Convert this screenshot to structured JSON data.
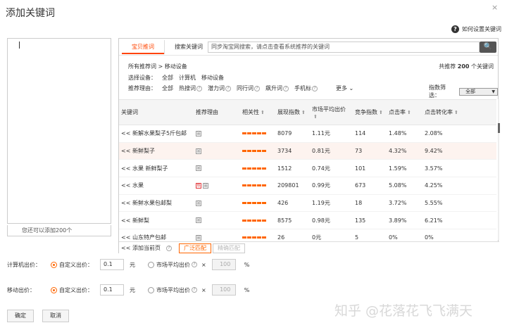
{
  "dialog": {
    "title": "添加关键词",
    "close_glyph": "×"
  },
  "help": {
    "icon_glyph": "?",
    "label": "如何设置关键词"
  },
  "left_panel": {
    "info": "您还可以添加200个"
  },
  "tabs": [
    {
      "label": "宝贝推词",
      "active": true
    },
    {
      "label": "搜索关键词",
      "active": false
    }
  ],
  "search": {
    "value": "同步淘宝网搜索，请点击查看系统推荐的关键词",
    "button_glyph": "🔍"
  },
  "breadcrumb": {
    "root": "所有推荐词",
    "sep": ">",
    "current": "移动设备"
  },
  "recommend": {
    "prefix": "共推荐",
    "count": "200",
    "suffix": "个关键词"
  },
  "device_filter": {
    "label": "选择设备：",
    "options": [
      "全部",
      "计算机",
      "移动设备"
    ]
  },
  "reason_filter": {
    "label": "推荐理由：",
    "options": [
      "全部",
      "热搜词",
      "潜力词",
      "同行词",
      "飙升词",
      "手机标"
    ],
    "more": "更多"
  },
  "index_filter": {
    "label": "指数筛选：",
    "value": "全部"
  },
  "table": {
    "headers": [
      "关键词",
      "推荐理由",
      "相关性",
      "展现指数",
      "市场平均出价",
      "竞争指数",
      "点击率",
      "点击转化率"
    ],
    "sort_glyph": "⬆",
    "add_glyph": "<<",
    "rows": [
      {
        "keyword": "新解水果梨子5斤包邮",
        "reason": [
          "品"
        ],
        "impr": "8079",
        "bid": "1.11元",
        "comp": "114",
        "ctr": "1.48%",
        "cvr": "2.08%"
      },
      {
        "keyword": "新鲜梨子",
        "reason": [
          "品"
        ],
        "impr": "3734",
        "bid": "0.81元",
        "comp": "73",
        "ctr": "4.32%",
        "cvr": "9.42%"
      },
      {
        "keyword": "水果 新鲜梨子",
        "reason": [
          "品"
        ],
        "impr": "1512",
        "bid": "0.74元",
        "comp": "101",
        "ctr": "1.59%",
        "cvr": "3.57%"
      },
      {
        "keyword": "水果",
        "reason": [
          "热",
          "品"
        ],
        "impr": "209801",
        "bid": "0.99元",
        "comp": "673",
        "ctr": "5.08%",
        "cvr": "4.25%"
      },
      {
        "keyword": "新鲜水果包邮梨",
        "reason": [
          "品"
        ],
        "impr": "426",
        "bid": "1.19元",
        "comp": "18",
        "ctr": "3.72%",
        "cvr": "5.55%"
      },
      {
        "keyword": "新鲜梨",
        "reason": [
          "品"
        ],
        "impr": "8575",
        "bid": "0.98元",
        "comp": "135",
        "ctr": "3.89%",
        "cvr": "6.21%"
      },
      {
        "keyword": "山东特产包邮",
        "reason": [
          "品"
        ],
        "impr": "26",
        "bid": "0元",
        "comp": "5",
        "ctr": "0%",
        "cvr": "0%"
      }
    ]
  },
  "bottom_bar": {
    "add_page": "<< 添加当前页",
    "match_broad": "广泛匹配",
    "match_exact": "精确匹配"
  },
  "pc_bid": {
    "label": "计算机出价：",
    "custom": "自定义出价：",
    "value": "0.1",
    "unit": "元",
    "market": "市场平均出价",
    "times": "×",
    "pct_value": "100",
    "pct": "%"
  },
  "mobile_bid": {
    "label": "移动出价：",
    "custom": "自定义出价：",
    "value": "0.1",
    "unit": "元",
    "market": "市场平均出价",
    "times": "×",
    "pct_value": "100",
    "pct": "%"
  },
  "buttons": {
    "ok": "确定",
    "cancel": "取消"
  },
  "watermark": "知乎 @花落花飞飞满天"
}
